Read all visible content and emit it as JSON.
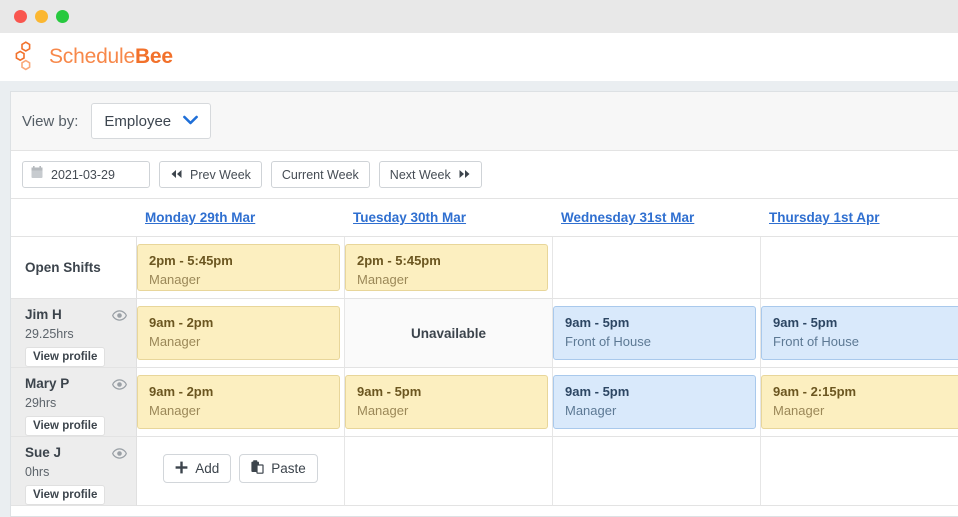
{
  "window": {
    "traffic_lights": [
      "close",
      "minimize",
      "maximize"
    ]
  },
  "brand": {
    "name_light": "Schedule",
    "name_bold": "Bee",
    "logo_icon": "honeycomb-icon"
  },
  "viewby": {
    "label": "View by:",
    "selected": "Employee",
    "options": [
      "Employee"
    ],
    "chevron_icon": "chevron-down-icon",
    "chevron_color": "#1f6fd8"
  },
  "toolbar": {
    "calendar_icon": "calendar-icon",
    "date_value": "2021-03-29",
    "prev_week": "Prev Week",
    "prev_icon": "double-chevron-left-icon",
    "current_week": "Current Week",
    "next_week": "Next Week",
    "next_icon": "double-chevron-right-icon"
  },
  "schedule": {
    "employee_column_header": "",
    "days": [
      "Monday 29th Mar",
      "Tuesday 30th Mar",
      "Wednesday 31st Mar",
      "Thursday 1st Apr"
    ],
    "open_shifts_label": "Open Shifts",
    "unavailable_label": "Unavailable",
    "view_profile_label": "View profile",
    "eye_icon": "eye-icon",
    "add_label": "Add",
    "add_icon": "plus-icon",
    "paste_label": "Paste",
    "paste_icon": "clipboard-icon",
    "colors": {
      "shift_yellow_bg": "#fcefc0",
      "shift_yellow_border": "#e8d69a",
      "shift_blue_bg": "#d9e9fb",
      "shift_blue_border": "#a9c9ec",
      "day_link": "#2f6fd0",
      "brand_orange": "#f2712b"
    },
    "rows": [
      {
        "type": "open",
        "name": "Open Shifts",
        "cells": [
          {
            "kind": "shift",
            "color": "yellow",
            "time": "2pm - 5:45pm",
            "role": "Manager"
          },
          {
            "kind": "shift",
            "color": "yellow",
            "time": "2pm - 5:45pm",
            "role": "Manager"
          },
          {
            "kind": "empty"
          },
          {
            "kind": "empty"
          }
        ]
      },
      {
        "type": "person",
        "name": "Jim H",
        "hours": "29.25hrs",
        "cells": [
          {
            "kind": "shift",
            "color": "yellow",
            "time": "9am - 2pm",
            "role": "Manager"
          },
          {
            "kind": "unavailable"
          },
          {
            "kind": "shift",
            "color": "blue",
            "time": "9am - 5pm",
            "role": "Front of House"
          },
          {
            "kind": "shift",
            "color": "blue",
            "time": "9am - 5pm",
            "role": "Front of House"
          }
        ]
      },
      {
        "type": "person",
        "name": "Mary P",
        "hours": "29hrs",
        "cells": [
          {
            "kind": "shift",
            "color": "yellow",
            "time": "9am - 2pm",
            "role": "Manager"
          },
          {
            "kind": "shift",
            "color": "yellow",
            "time": "9am - 5pm",
            "role": "Manager"
          },
          {
            "kind": "shift",
            "color": "blue",
            "time": "9am - 5pm",
            "role": "Manager"
          },
          {
            "kind": "shift",
            "color": "yellow",
            "time": "9am - 2:15pm",
            "role": "Manager"
          }
        ]
      },
      {
        "type": "person",
        "name": "Sue J",
        "hours": "0hrs",
        "cells": [
          {
            "kind": "actions"
          },
          {
            "kind": "empty"
          },
          {
            "kind": "empty"
          },
          {
            "kind": "empty"
          }
        ]
      }
    ]
  }
}
